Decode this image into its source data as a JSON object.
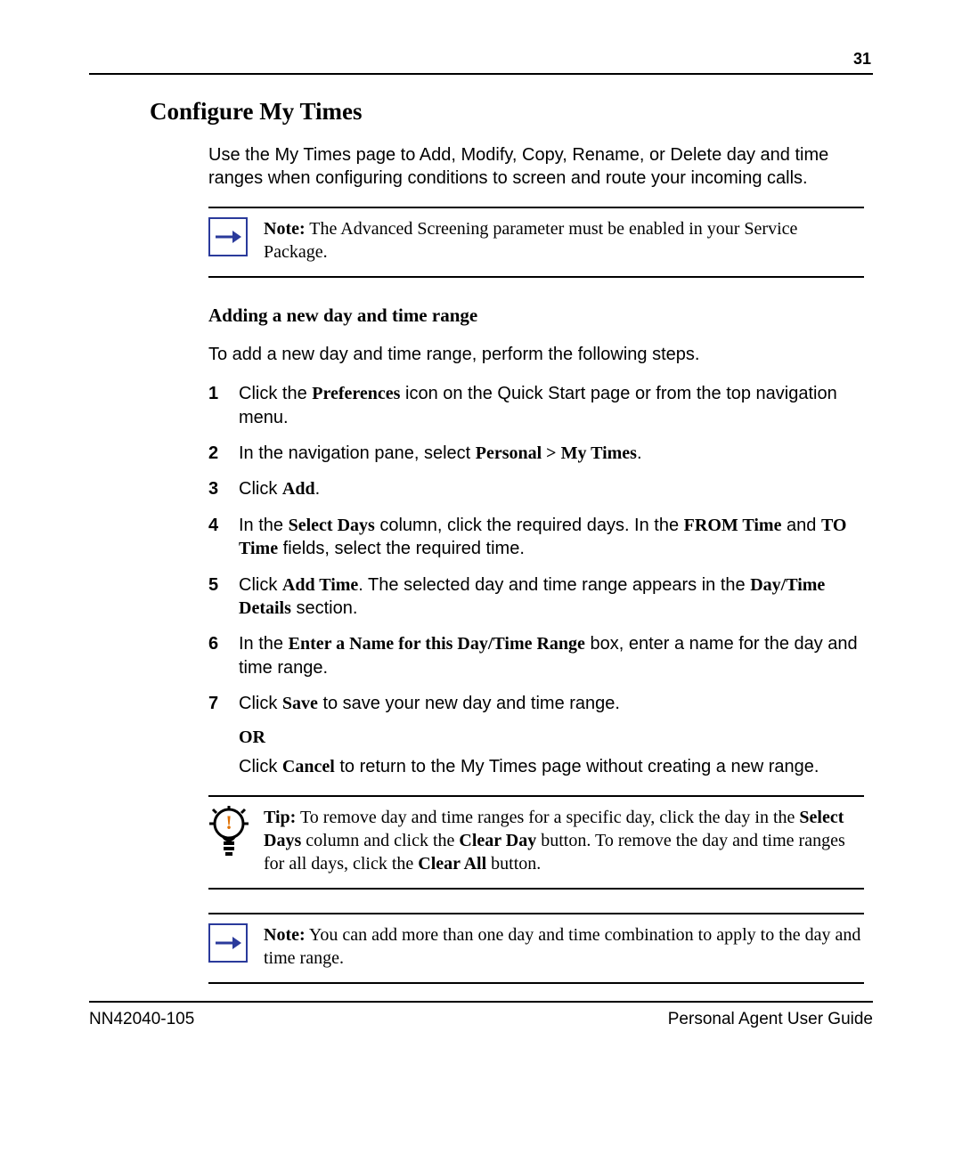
{
  "page_number": "31",
  "h2": "Configure My Times",
  "intro": "Use the My Times page to Add, Modify, Copy, Rename, or Delete day and time ranges when configuring conditions to screen and route your incoming calls.",
  "note1_label": "Note:",
  "note1_text": " The Advanced Screening parameter must be enabled in your Service Package.",
  "h3": "Adding a new day and time range",
  "lead": "To add a new day and time range, perform the following steps.",
  "steps": {
    "s1a": "Click the ",
    "s1b": "Preferences",
    "s1c": " icon on the Quick Start page or from the top navigation menu.",
    "s2a": "In the navigation pane, select ",
    "s2b": "Personal > My Times",
    "s2c": ".",
    "s3a": "Click ",
    "s3b": "Add",
    "s3c": ".",
    "s4a": "In the ",
    "s4b": "Select Days",
    "s4c": " column, click the required days.  In the ",
    "s4d": "FROM Time",
    "s4e": " and ",
    "s4f": "TO Time",
    "s4g": " fields, select the required time.",
    "s5a": "Click ",
    "s5b": "Add Time",
    "s5c": ".  The selected day and time range appears in the ",
    "s5d": "Day/Time Details",
    "s5e": " section.",
    "s6a": "In the ",
    "s6b": "Enter a Name for this Day/Time Range",
    "s6c": " box, enter a name for the day and time range.",
    "s7a": "Click ",
    "s7b": "Save",
    "s7c": " to save your new day and time range.",
    "or": "OR",
    "s7d": "Click ",
    "s7e": "Cancel",
    "s7f": " to return to the My Times page without creating a new range."
  },
  "tip_label": "Tip:",
  "tip_a": " To remove day and time ranges for a specific day, click the day in the ",
  "tip_b": "Select Days",
  "tip_c": " column and click the ",
  "tip_d": "Clear Day",
  "tip_e": " button. To remove the day and time ranges for all days, click the ",
  "tip_f": "Clear All",
  "tip_g": " button.",
  "note2_label": "Note:",
  "note2_text": " You can add more than one day and time combination to apply to the day and time range.",
  "footer_left": "NN42040-105",
  "footer_right": "Personal Agent User Guide",
  "nums": {
    "n1": "1",
    "n2": "2",
    "n3": "3",
    "n4": "4",
    "n5": "5",
    "n6": "6",
    "n7": "7"
  }
}
